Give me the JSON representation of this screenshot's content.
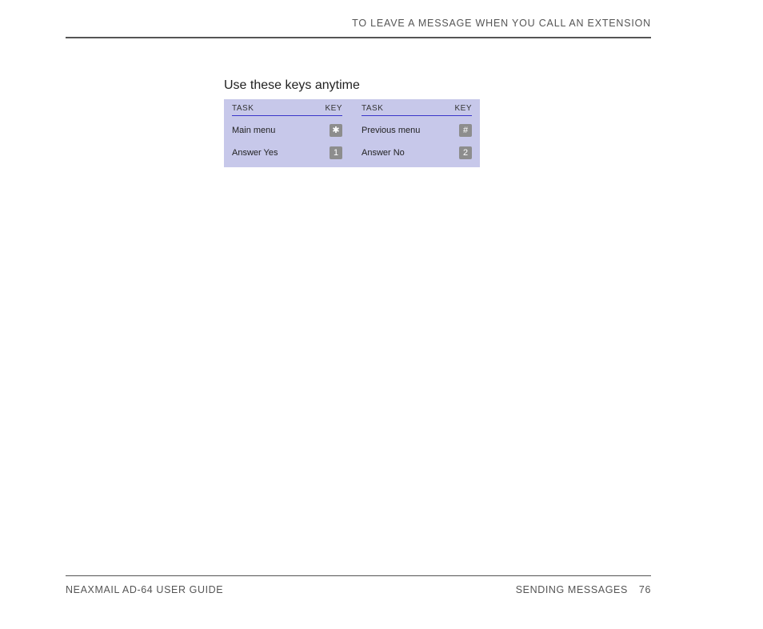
{
  "header": {
    "title": "TO LEAVE A MESSAGE WHEN YOU CALL AN EXTENSION"
  },
  "section": {
    "title": "Use these keys anytime",
    "columns": {
      "task_header": "TASK",
      "key_header": "KEY"
    },
    "left_rows": [
      {
        "task": "Main menu",
        "key": "✱"
      },
      {
        "task": "Answer Yes",
        "key": "1"
      }
    ],
    "right_rows": [
      {
        "task": "Previous menu",
        "key": "#"
      },
      {
        "task": "Answer No",
        "key": "2"
      }
    ]
  },
  "footer": {
    "left": "NEAXMAIL AD-64 USER GUIDE",
    "right_section": "SENDING MESSAGES",
    "page_number": "76"
  }
}
